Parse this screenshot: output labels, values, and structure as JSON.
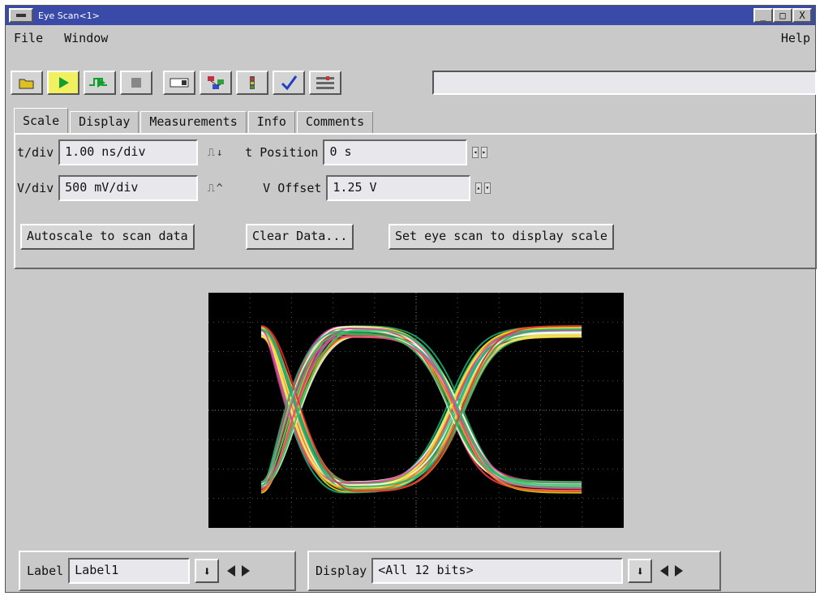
{
  "window": {
    "title": "Eye Scan<1>",
    "controls": [
      "_",
      "□",
      "X"
    ]
  },
  "menu": {
    "file": "File",
    "window": "Window",
    "help": "Help"
  },
  "toolbar": {
    "icons": [
      "open-folder-icon",
      "run-icon",
      "run-repetitive-icon",
      "stop-icon",
      "module-icon",
      "group-run-icon",
      "status-icon",
      "check-icon",
      "settings-icon"
    ],
    "status_text": ""
  },
  "tabs": [
    "Scale",
    "Display",
    "Measurements",
    "Info",
    "Comments"
  ],
  "active_tab": "Scale",
  "scale": {
    "tdiv_label": "t/div",
    "tdiv_value": "1.00 ns/div",
    "tpos_label": "t Position",
    "tpos_value": "0 s",
    "vdiv_label": "V/div",
    "vdiv_value": "500 mV/div",
    "voffset_label": "V Offset",
    "voffset_value": "1.25 V"
  },
  "buttons": {
    "autoscale": "Autoscale to scan data",
    "clear": "Clear Data...",
    "set_eye": "Set eye scan to display scale"
  },
  "bottom": {
    "label_label": "Label",
    "label_value": "Label1",
    "display_label": "Display",
    "display_value": "<All 12 bits>"
  },
  "colors": {
    "trace_colors": [
      "#1fb07a",
      "#e03030",
      "#f07820",
      "#f0e020",
      "#e040a0",
      "#30c060",
      "#ffe060",
      "#ffffff"
    ]
  }
}
